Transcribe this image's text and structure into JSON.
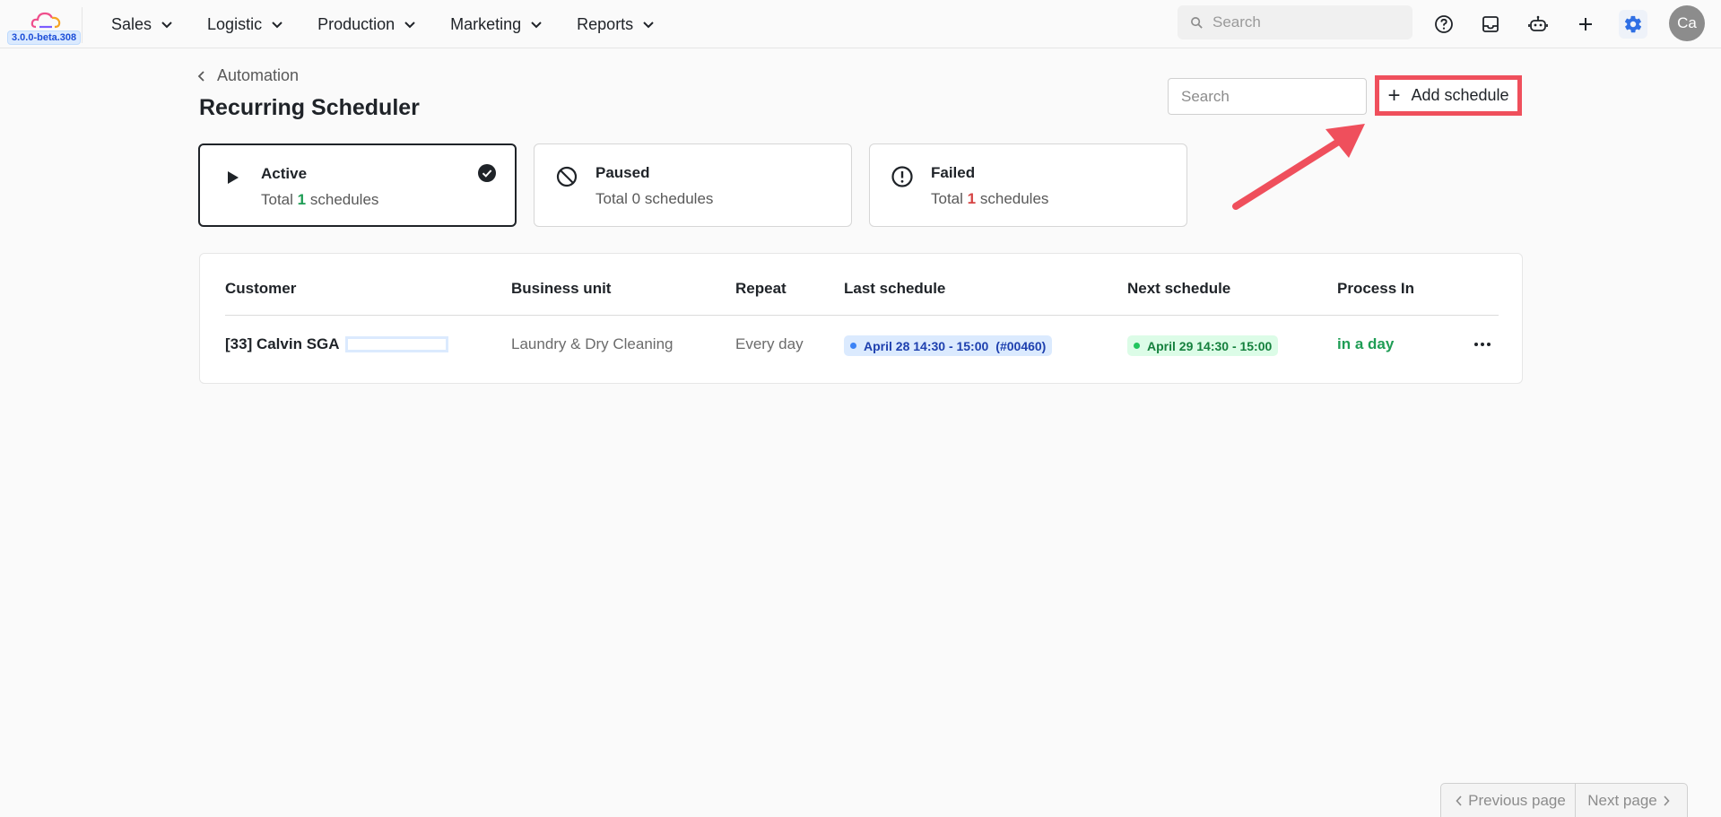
{
  "app": {
    "version": "3.0.0-beta.308"
  },
  "nav": {
    "items": [
      {
        "label": "Sales"
      },
      {
        "label": "Logistic"
      },
      {
        "label": "Production"
      },
      {
        "label": "Marketing"
      },
      {
        "label": "Reports"
      }
    ]
  },
  "topbar": {
    "search_placeholder": "Search",
    "avatar_initials": "Ca",
    "icons": [
      "help-icon",
      "inbox-icon",
      "robot-icon",
      "plus-icon",
      "gear-icon"
    ]
  },
  "page": {
    "breadcrumb": "Automation",
    "title": "Recurring Scheduler",
    "search_placeholder": "Search",
    "add_button": "Add schedule"
  },
  "status_cards": [
    {
      "title": "Active",
      "prefix": "Total",
      "count": "1",
      "suffix": "schedules",
      "selected": true
    },
    {
      "title": "Paused",
      "prefix": "Total",
      "count": "0",
      "suffix": "schedules",
      "selected": false
    },
    {
      "title": "Failed",
      "prefix": "Total",
      "count": "1",
      "suffix": "schedules",
      "selected": false
    }
  ],
  "table": {
    "columns": [
      "Customer",
      "Business unit",
      "Repeat",
      "Last schedule",
      "Next schedule",
      "Process In"
    ],
    "rows": [
      {
        "customer": "[33] Calvin SGA",
        "business_unit": "Laundry & Dry Cleaning",
        "repeat": "Every day",
        "last_schedule": "April 28 14:30 - 15:00",
        "last_schedule_ref": "(#00460)",
        "next_schedule": "April 29 14:30 - 15:00",
        "process_in": "in a day"
      }
    ]
  },
  "pagination": {
    "prev": "Previous page",
    "next": "Next page"
  },
  "colors": {
    "accent_red": "#ef4f5c",
    "green": "#1f9d55",
    "red": "#d64545",
    "blue_pill": "#dbeafe"
  }
}
